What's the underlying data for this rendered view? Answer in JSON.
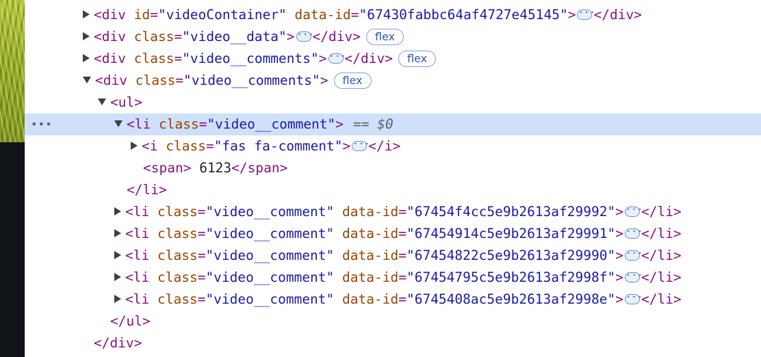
{
  "rows": [
    {
      "indent": 84,
      "toggle": "closed",
      "open_tag": "<div",
      "attrs": [
        {
          "name": "id",
          "value": "\"videoContainer\""
        },
        {
          "name": "data-id",
          "value": "\"67430fabbc64af4727e45145\""
        }
      ],
      "close_open": ">",
      "ellipsis": true,
      "end_tag": "</div>",
      "badge": ""
    },
    {
      "indent": 84,
      "toggle": "closed",
      "open_tag": "<div",
      "attrs": [
        {
          "name": "class",
          "value": "\"video__data\""
        }
      ],
      "close_open": ">",
      "ellipsis": true,
      "end_tag": "</div>",
      "badge": "flex"
    },
    {
      "indent": 84,
      "toggle": "closed",
      "open_tag": "<div",
      "attrs": [
        {
          "name": "class",
          "value": "\"video__comments\""
        }
      ],
      "close_open": ">",
      "ellipsis": true,
      "end_tag": "</div>",
      "badge": "flex"
    },
    {
      "indent": 84,
      "toggle": "open",
      "open_tag": "<div",
      "attrs": [
        {
          "name": "class",
          "value": "\"video__comments\""
        }
      ],
      "close_open": ">",
      "ellipsis": false,
      "end_tag": "",
      "badge": "flex"
    },
    {
      "indent": 106,
      "toggle": "open",
      "open_tag": "<ul",
      "attrs": [],
      "close_open": ">",
      "ellipsis": false,
      "end_tag": "",
      "badge": ""
    },
    {
      "indent": 130,
      "toggle": "open",
      "open_tag": "<li",
      "attrs": [
        {
          "name": "class",
          "value": "\"video__comment\""
        }
      ],
      "close_open": ">",
      "ellipsis": false,
      "end_tag": "",
      "badge": "",
      "selected": true,
      "ref": "== $0"
    },
    {
      "indent": 154,
      "toggle": "closed",
      "open_tag": "<i",
      "attrs": [
        {
          "name": "class",
          "value": "\"fas fa-comment\""
        }
      ],
      "close_open": ">",
      "ellipsis": true,
      "end_tag": "</i>",
      "badge": ""
    },
    {
      "indent": 172,
      "toggle": "none",
      "open_tag": "<span",
      "attrs": [],
      "close_open": ">",
      "ellipsis": false,
      "text": " 6123",
      "end_tag": "</span>",
      "badge": ""
    },
    {
      "indent": 148,
      "toggle": "none",
      "open_tag": "",
      "attrs": [],
      "close_open": "",
      "ellipsis": false,
      "end_tag": "</li>",
      "badge": ""
    },
    {
      "indent": 130,
      "toggle": "closed",
      "open_tag": "<li",
      "attrs": [
        {
          "name": "class",
          "value": "\"video__comment\""
        },
        {
          "name": "data-id",
          "value": "\"67454f4cc5e9b2613af29992\""
        }
      ],
      "close_open": ">",
      "ellipsis": true,
      "end_tag": "</li>",
      "badge": ""
    },
    {
      "indent": 130,
      "toggle": "closed",
      "open_tag": "<li",
      "attrs": [
        {
          "name": "class",
          "value": "\"video__comment\""
        },
        {
          "name": "data-id",
          "value": "\"67454914c5e9b2613af29991\""
        }
      ],
      "close_open": ">",
      "ellipsis": true,
      "end_tag": "</li>",
      "badge": ""
    },
    {
      "indent": 130,
      "toggle": "closed",
      "open_tag": "<li",
      "attrs": [
        {
          "name": "class",
          "value": "\"video__comment\""
        },
        {
          "name": "data-id",
          "value": "\"67454822c5e9b2613af29990\""
        }
      ],
      "close_open": ">",
      "ellipsis": true,
      "end_tag": "</li>",
      "badge": ""
    },
    {
      "indent": 130,
      "toggle": "closed",
      "open_tag": "<li",
      "attrs": [
        {
          "name": "class",
          "value": "\"video__comment\""
        },
        {
          "name": "data-id",
          "value": "\"67454795c5e9b2613af2998f\""
        }
      ],
      "close_open": ">",
      "ellipsis": true,
      "end_tag": "</li>",
      "badge": ""
    },
    {
      "indent": 130,
      "toggle": "closed",
      "open_tag": "<li",
      "attrs": [
        {
          "name": "class",
          "value": "\"video__comment\""
        },
        {
          "name": "data-id",
          "value": "\"6745408ac5e9b2613af2998e\""
        }
      ],
      "close_open": ">",
      "ellipsis": true,
      "end_tag": "</li>",
      "badge": ""
    },
    {
      "indent": 124,
      "toggle": "none",
      "open_tag": "",
      "attrs": [],
      "close_open": "",
      "ellipsis": false,
      "end_tag": "</ul>",
      "badge": ""
    },
    {
      "indent": 100,
      "toggle": "none",
      "open_tag": "",
      "attrs": [],
      "close_open": "",
      "ellipsis": false,
      "end_tag": "</div>",
      "badge": ""
    }
  ],
  "row_menu": "•••",
  "ellipsis_glyph": "···",
  "colors": {
    "tag": "#881280",
    "attr_name": "#994500",
    "attr_value": "#1a1aa6",
    "selection": "#cfe0fb",
    "badge": "#2a56b8"
  }
}
